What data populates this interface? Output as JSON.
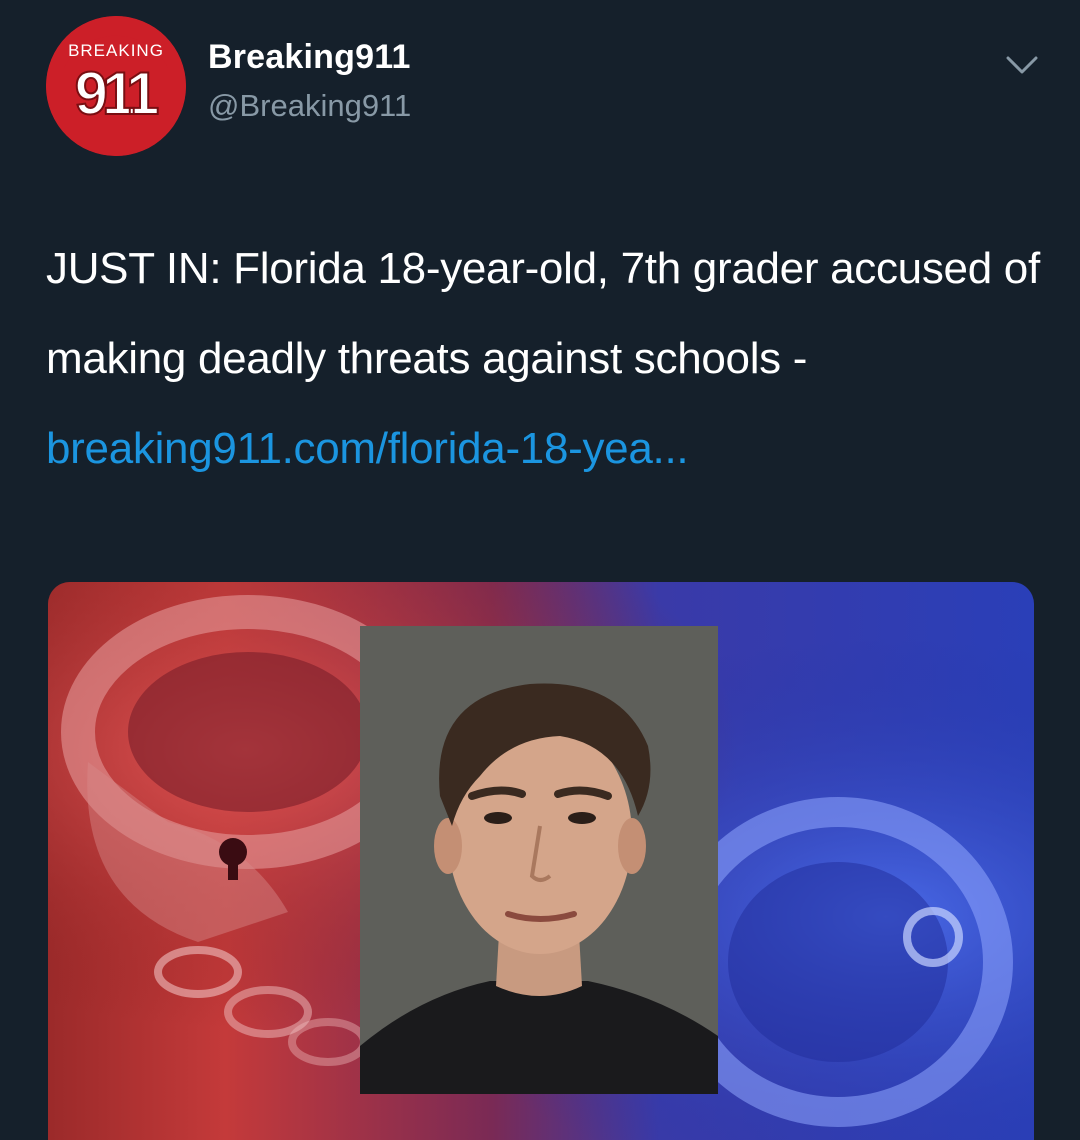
{
  "account": {
    "display_name": "Breaking911",
    "handle": "@Breaking911",
    "avatar": {
      "top_text": "BREAKING",
      "number": "911",
      "background_color": "#cc1f28"
    }
  },
  "menu": {
    "icon": "chevron-down-icon"
  },
  "tweet": {
    "text": "JUST IN: Florida 18-year-old, 7th grader accused of making deadly threats against schools - ",
    "link_text": "breaking911.com/florida-18-yea..."
  },
  "media": {
    "description_icon": "mugshot-photo",
    "background": "handcuffs-red-blue"
  },
  "colors": {
    "background": "#15202b",
    "text": "#ffffff",
    "secondary_text": "#8899a6",
    "link": "#1b95e0"
  }
}
